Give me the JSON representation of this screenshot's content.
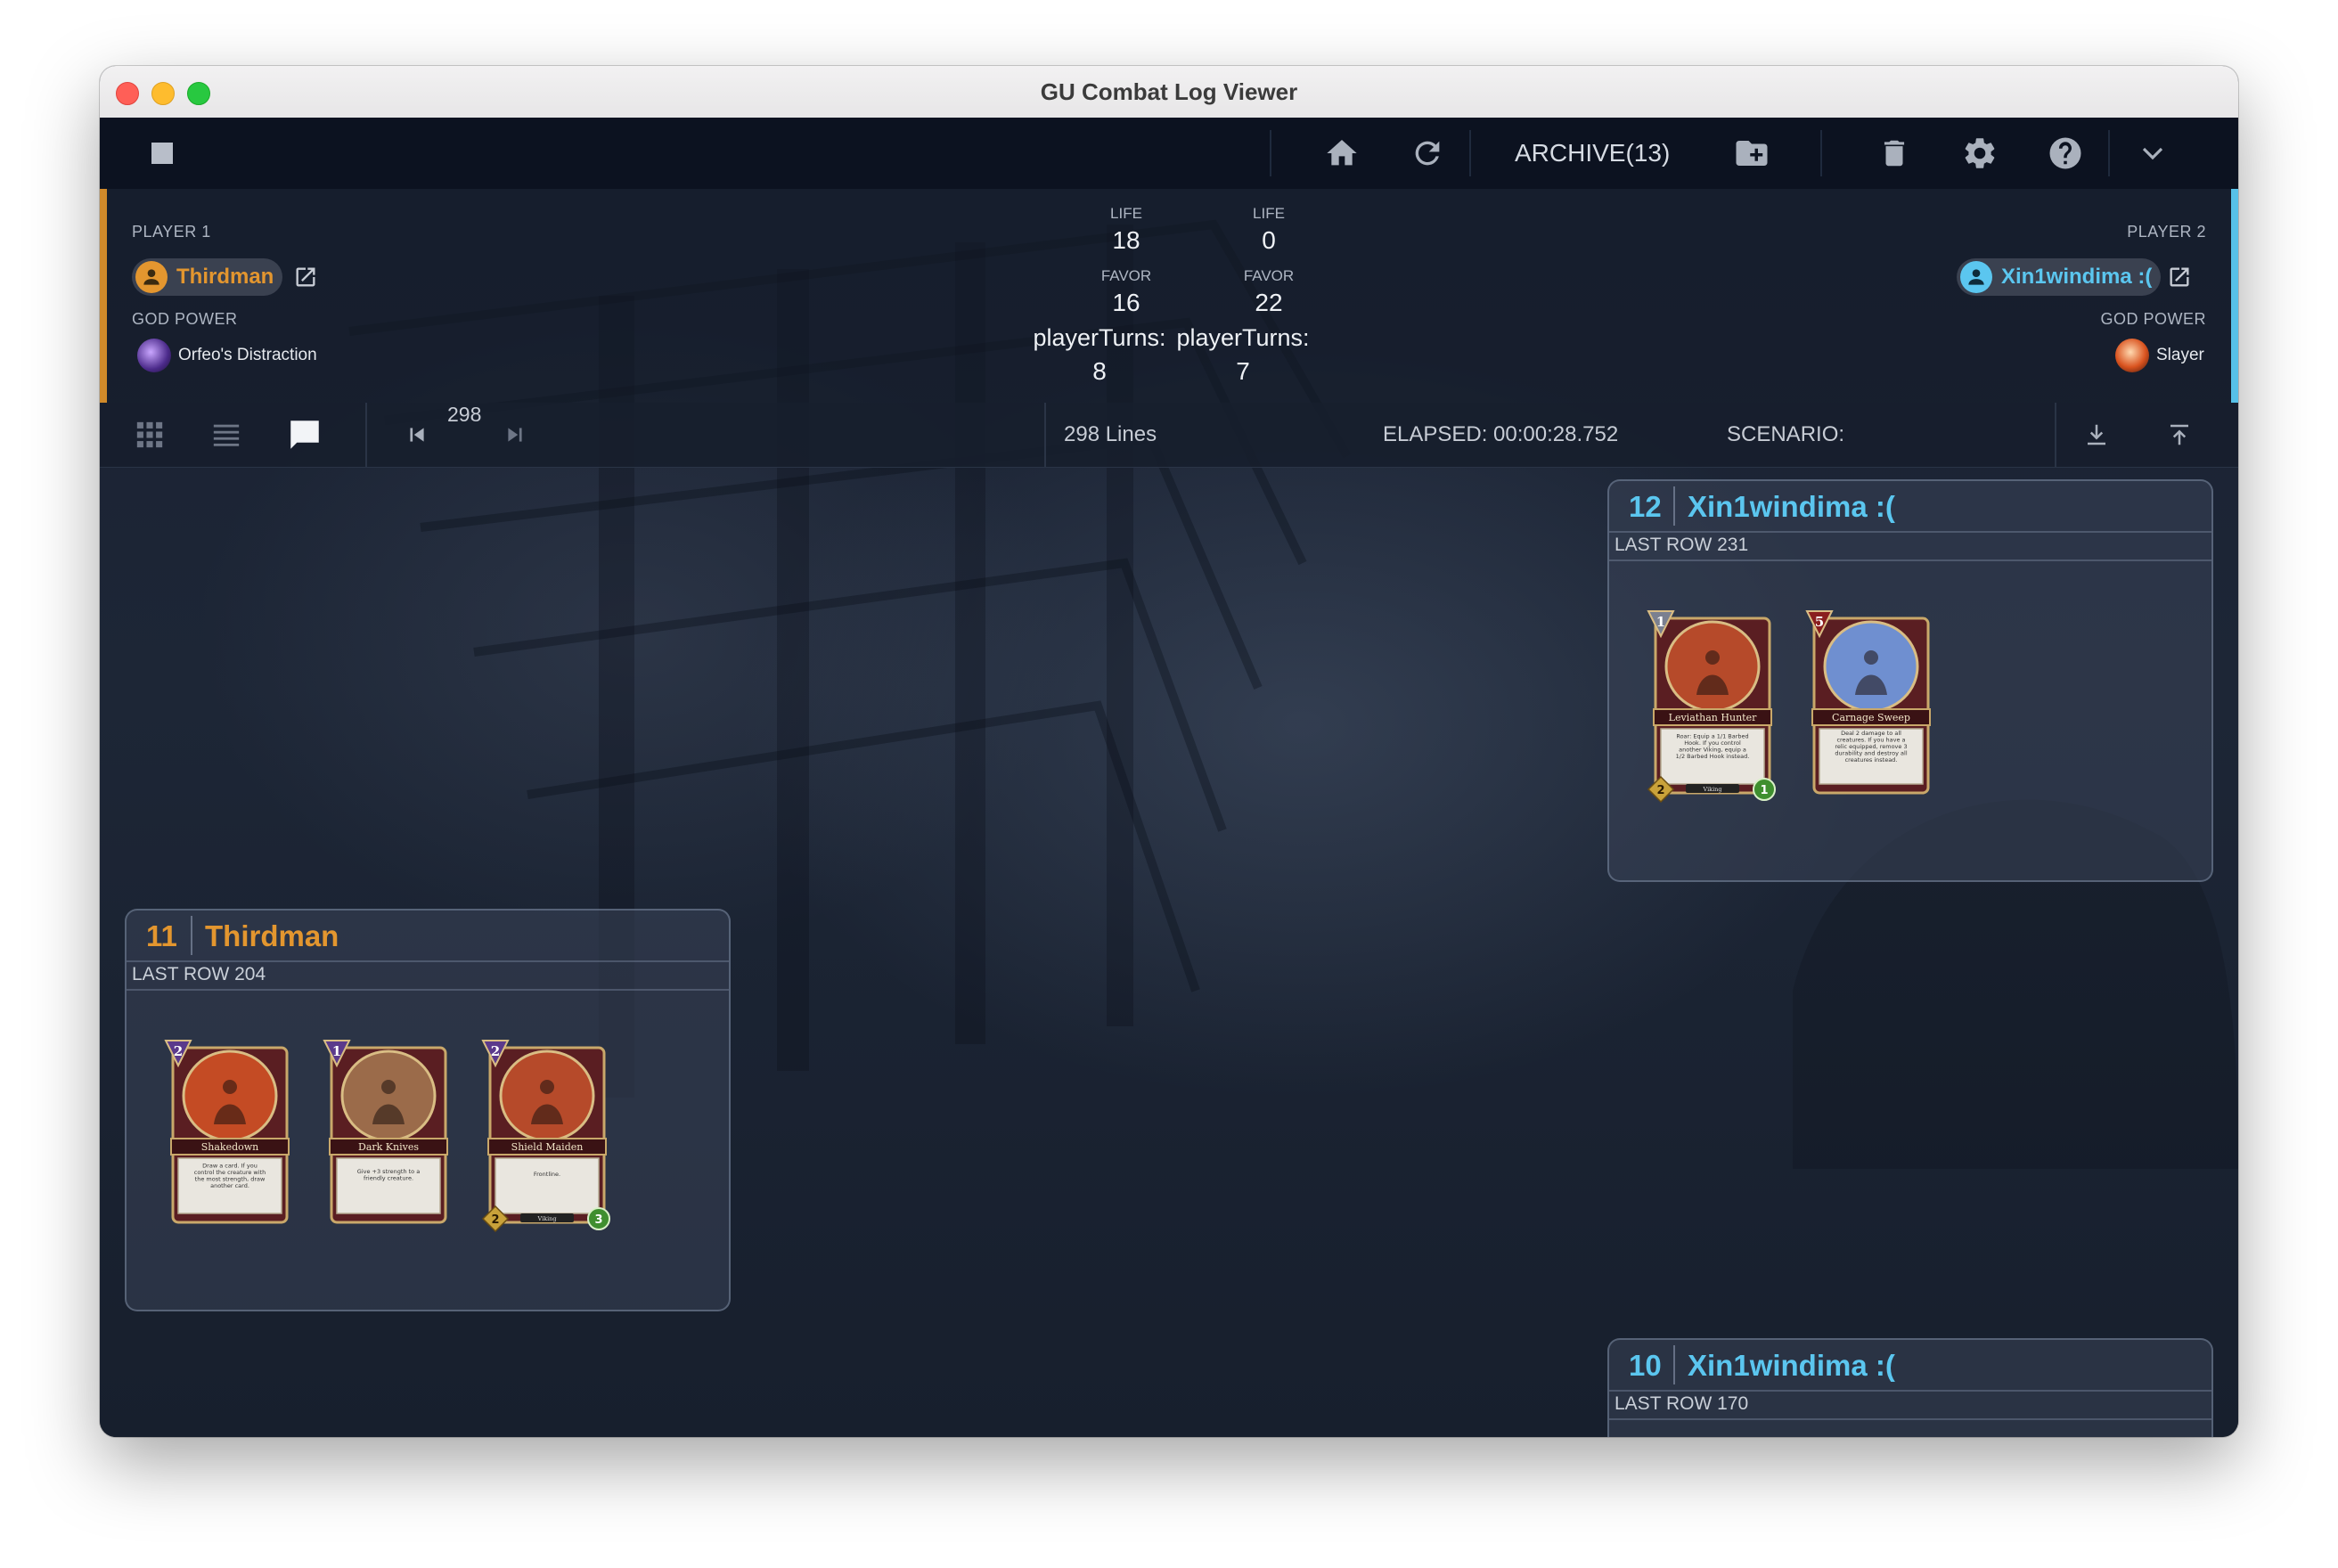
{
  "window": {
    "title": "GU Combat Log Viewer"
  },
  "toolbar": {
    "archive_label": "ARCHIVE(13)",
    "icons": [
      "stop-icon",
      "home-icon",
      "refresh-icon",
      "folder-add-icon",
      "trash-icon",
      "gear-icon",
      "help-icon",
      "chevron-down-icon"
    ]
  },
  "player1": {
    "label": "PLAYER 1",
    "name": "Thirdman",
    "god_power_label": "GOD POWER",
    "god_power": "Orfeo's Distraction",
    "color": "#e3962f"
  },
  "player2": {
    "label": "PLAYER 2",
    "name": "Xin1windima :(",
    "god_power_label": "GOD POWER",
    "god_power": "Slayer",
    "color": "#5bc6ef"
  },
  "stats": {
    "p1": {
      "life_label": "LIFE",
      "life": "18",
      "favor_label": "FAVOR",
      "favor": "16",
      "turns_label": "playerTurns:",
      "turns": "8"
    },
    "p2": {
      "life_label": "LIFE",
      "life": "0",
      "favor_label": "FAVOR",
      "favor": "22",
      "turns_label": "playerTurns:",
      "turns": "7"
    }
  },
  "viewbar": {
    "line_position": "298",
    "lines": "298 Lines",
    "elapsed": "ELAPSED: 00:00:28.752",
    "scenario": "SCENARIO:"
  },
  "turns": [
    {
      "number": "12",
      "player": "Xin1windima :(",
      "last_row": "LAST ROW 231",
      "side": "p2",
      "cards": [
        {
          "name": "Leviathan Hunter",
          "cost": "1",
          "text": "Roar: Equip a 1/1 Barbed Hook. If you control another Viking, equip a 1/2 Barbed Hook instead.",
          "tribe": "Viking",
          "attack": "2",
          "health": "1",
          "type": "creature"
        },
        {
          "name": "Carnage Sweep",
          "cost": "5",
          "text": "Deal 2 damage to all creatures. If you have a relic equipped, remove 3 durability and destroy all creatures instead.",
          "type": "spell"
        }
      ]
    },
    {
      "number": "11",
      "player": "Thirdman",
      "last_row": "LAST ROW 204",
      "side": "p1",
      "cards": [
        {
          "name": "Shakedown",
          "cost": "2",
          "text": "Draw a card. If you control the creature with the most strength, draw another card.",
          "type": "spell"
        },
        {
          "name": "Dark Knives",
          "cost": "1",
          "text": "Give +3 strength to a friendly creature.",
          "type": "spell"
        },
        {
          "name": "Shield Maiden",
          "cost": "2",
          "text": "Frontline.",
          "tribe": "Viking",
          "attack": "2",
          "health": "3",
          "type": "creature"
        }
      ]
    },
    {
      "number": "10",
      "player": "Xin1windima :(",
      "last_row": "LAST ROW 170",
      "side": "p2",
      "cards": []
    }
  ]
}
